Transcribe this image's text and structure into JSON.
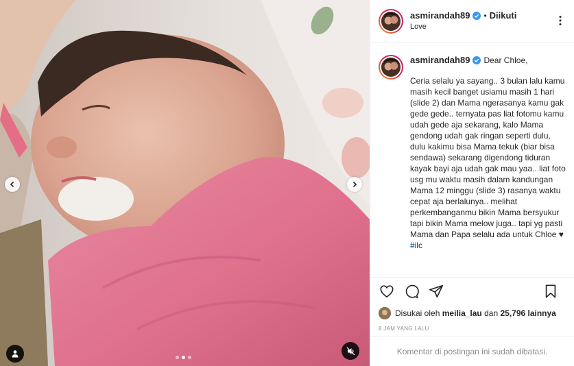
{
  "post": {
    "username": "asmirandah89",
    "follow_separator": "•",
    "follow_state": "Diikuti",
    "location": "Love",
    "caption_greeting": "Dear Chloe,",
    "caption_text": "Ceria selalu ya sayang.. 3 bulan lalu kamu masih kecil banget usiamu masih 1 hari (slide 2) dan Mama ngerasanya kamu gak gede gede.. ternyata pas liat fotomu kamu udah gede aja sekarang, kalo Mama gendong udah gak ringan seperti dulu, dulu kakimu bisa Mama tekuk (biar bisa sendawa) sekarang digendong tiduran kayak bayi aja udah gak mau yaa.. liat foto usg mu waktu masih dalam kandungan Mama 12 minggu (slide 3) rasanya waktu cepat aja berlalunya.. melihat perkembanganmu bikin Mama bersyukur tapi bikin Mama melow juga.. tapi yg pasti Mama dan Papa selalu ada untuk Chloe ♥",
    "hashtag": "#ilc",
    "likes_prefix": "Disukai oleh",
    "liked_by_user": "meilia_lau",
    "likes_conjunction": "dan",
    "likes_count": "25,796 lainnya",
    "timestamp": "8 JAM YANG LALU",
    "comments_disabled": "Komentar di postingan ini sudah dibatasi."
  },
  "carousel": {
    "slide_count": 3,
    "active_slide": 2
  },
  "icons": {
    "verified": "verified-badge-icon",
    "like": "heart-icon",
    "comment": "comment-icon",
    "share": "share-icon",
    "save": "bookmark-icon",
    "prev": "chevron-left-icon",
    "next": "chevron-right-icon",
    "user_tag": "user-tag-icon",
    "mute": "mute-icon",
    "more": "more-options-icon"
  },
  "colors": {
    "verified_blue": "#3897f0",
    "hashtag_blue": "#00376b",
    "muted_text": "#8e8e8e",
    "blanket_pink": "#e07a92"
  }
}
